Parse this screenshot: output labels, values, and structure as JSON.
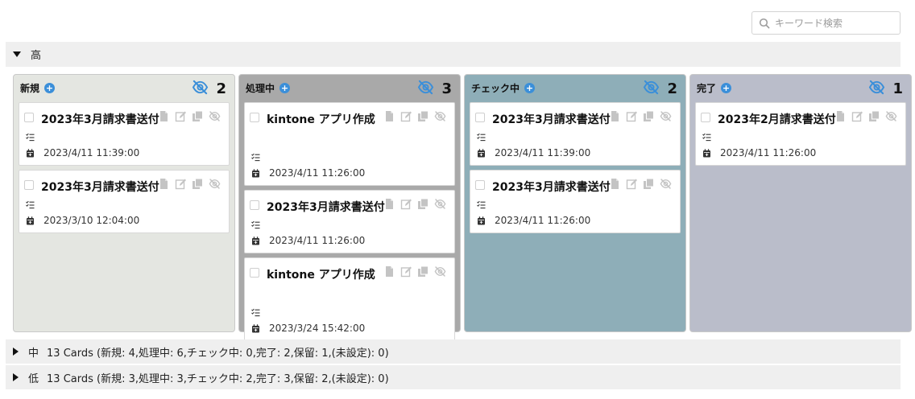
{
  "search": {
    "placeholder": "キーワード検索"
  },
  "groups": [
    {
      "level": "高",
      "expanded": true,
      "summary": ""
    },
    {
      "level": "中",
      "expanded": false,
      "summary": "13 Cards (新規: 4,処理中: 6,チェック中: 0,完了: 2,保留: 1,(未設定): 0)"
    },
    {
      "level": "低",
      "expanded": false,
      "summary": "13 Cards (新規: 3,処理中: 3,チェック中: 2,完了: 3,保留: 2,(未設定): 0)"
    }
  ],
  "columns": [
    {
      "title": "新規",
      "count": "2",
      "color": "#e4e6e1",
      "cards": [
        {
          "title": "2023年3月請求書送付",
          "date": "2023/4/11 11:39:00"
        },
        {
          "title": "2023年3月請求書送付",
          "date": "2023/3/10 12:04:00"
        }
      ]
    },
    {
      "title": "処理中",
      "count": "3",
      "color": "#a9a9a9",
      "cards": [
        {
          "title": "kintone アプリ作成",
          "date": "2023/4/11 11:26:00"
        },
        {
          "title": "2023年3月請求書送付",
          "date": "2023/4/11 11:26:00"
        },
        {
          "title": "kintone アプリ作成",
          "date": "2023/3/24 15:42:00"
        }
      ]
    },
    {
      "title": "チェック中",
      "count": "2",
      "color": "#8eaeb8",
      "cards": [
        {
          "title": "2023年3月請求書送付",
          "date": "2023/4/11 11:39:00"
        },
        {
          "title": "2023年3月請求書送付",
          "date": "2023/4/11 11:26:00"
        }
      ]
    },
    {
      "title": "完了",
      "count": "1",
      "color": "#babdca",
      "cards": [
        {
          "title": "2023年2月請求書送付",
          "date": "2023/4/11 11:26:00"
        }
      ]
    }
  ],
  "colors": {
    "accent": "#3b8fd9",
    "icon": "#c4c4c4"
  },
  "icons": {
    "search": "search-icon",
    "hide": "eye-slash-icon",
    "add": "plus-circle-icon",
    "document": "document-icon",
    "edit": "edit-icon",
    "copy": "copy-icon",
    "subtask": "task-list-icon",
    "date": "calendar-icon",
    "expand": "triangle-icon"
  }
}
